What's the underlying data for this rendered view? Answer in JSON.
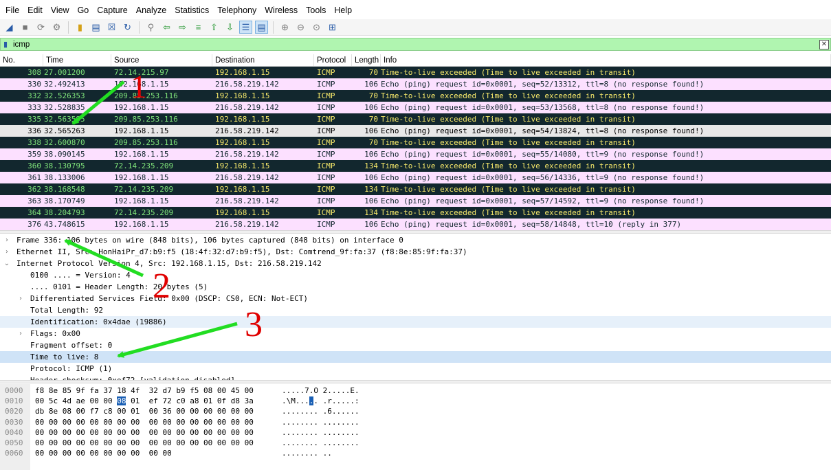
{
  "menu": [
    "File",
    "Edit",
    "View",
    "Go",
    "Capture",
    "Analyze",
    "Statistics",
    "Telephony",
    "Wireless",
    "Tools",
    "Help"
  ],
  "toolbar": {
    "icons": [
      "shark-fin-start-icon",
      "stop-square-icon",
      "restart-icon",
      "capture-options-gear-icon",
      "open-folder-icon",
      "save-file-icon",
      "close-file-icon",
      "reload-icon",
      "find-magnifier-icon",
      "go-back-arrow-icon",
      "go-forward-arrow-icon",
      "go-to-packet-icon",
      "go-first-icon",
      "go-last-icon",
      "autoscroll-icon",
      "colorize-icon",
      "zoom-in-icon",
      "zoom-out-icon",
      "zoom-normal-icon",
      "resize-columns-icon"
    ]
  },
  "filter": {
    "value": "icmp"
  },
  "columns": [
    "No.",
    "Time",
    "Source",
    "Destination",
    "Protocol",
    "Length",
    "Info"
  ],
  "packets": [
    {
      "no": "308",
      "time": "27.001200",
      "src": "72.14.215.97",
      "dst": "192.168.1.15",
      "proto": "ICMP",
      "len": "70",
      "info": "Time-to-live exceeded (Time to live exceeded in transit)",
      "style": "dark"
    },
    {
      "no": "330",
      "time": "32.492413",
      "src": "192.168.1.15",
      "dst": "216.58.219.142",
      "proto": "ICMP",
      "len": "106",
      "info": "Echo (ping) request  id=0x0001, seq=52/13312, ttl=8 (no response found!)",
      "style": "pink"
    },
    {
      "no": "332",
      "time": "32.526353",
      "src": "209.85.253.116",
      "dst": "192.168.1.15",
      "proto": "ICMP",
      "len": "70",
      "info": "Time-to-live exceeded (Time to live exceeded in transit)",
      "style": "dark"
    },
    {
      "no": "333",
      "time": "32.528835",
      "src": "192.168.1.15",
      "dst": "216.58.219.142",
      "proto": "ICMP",
      "len": "106",
      "info": "Echo (ping) request  id=0x0001, seq=53/13568, ttl=8 (no response found!)",
      "style": "pink"
    },
    {
      "no": "335",
      "time": "32.563595",
      "src": "209.85.253.116",
      "dst": "192.168.1.15",
      "proto": "ICMP",
      "len": "70",
      "info": "Time-to-live exceeded (Time to live exceeded in transit)",
      "style": "dark"
    },
    {
      "no": "336",
      "time": "32.565263",
      "src": "192.168.1.15",
      "dst": "216.58.219.142",
      "proto": "ICMP",
      "len": "106",
      "info": "Echo (ping) request  id=0x0001, seq=54/13824, ttl=8 (no response found!)",
      "style": "sel"
    },
    {
      "no": "338",
      "time": "32.600870",
      "src": "209.85.253.116",
      "dst": "192.168.1.15",
      "proto": "ICMP",
      "len": "70",
      "info": "Time-to-live exceeded (Time to live exceeded in transit)",
      "style": "dark"
    },
    {
      "no": "359",
      "time": "38.090145",
      "src": "192.168.1.15",
      "dst": "216.58.219.142",
      "proto": "ICMP",
      "len": "106",
      "info": "Echo (ping) request  id=0x0001, seq=55/14080, ttl=9 (no response found!)",
      "style": "pink"
    },
    {
      "no": "360",
      "time": "38.130795",
      "src": "72.14.235.209",
      "dst": "192.168.1.15",
      "proto": "ICMP",
      "len": "134",
      "info": "Time-to-live exceeded (Time to live exceeded in transit)",
      "style": "dark"
    },
    {
      "no": "361",
      "time": "38.133006",
      "src": "192.168.1.15",
      "dst": "216.58.219.142",
      "proto": "ICMP",
      "len": "106",
      "info": "Echo (ping) request  id=0x0001, seq=56/14336, ttl=9 (no response found!)",
      "style": "pink"
    },
    {
      "no": "362",
      "time": "38.168548",
      "src": "72.14.235.209",
      "dst": "192.168.1.15",
      "proto": "ICMP",
      "len": "134",
      "info": "Time-to-live exceeded (Time to live exceeded in transit)",
      "style": "dark"
    },
    {
      "no": "363",
      "time": "38.170749",
      "src": "192.168.1.15",
      "dst": "216.58.219.142",
      "proto": "ICMP",
      "len": "106",
      "info": "Echo (ping) request  id=0x0001, seq=57/14592, ttl=9 (no response found!)",
      "style": "pink"
    },
    {
      "no": "364",
      "time": "38.204793",
      "src": "72.14.235.209",
      "dst": "192.168.1.15",
      "proto": "ICMP",
      "len": "134",
      "info": "Time-to-live exceeded (Time to live exceeded in transit)",
      "style": "dark"
    },
    {
      "no": "376",
      "time": "43.748615",
      "src": "192.168.1.15",
      "dst": "216.58.219.142",
      "proto": "ICMP",
      "len": "106",
      "info": "Echo (ping) request  id=0x0001, seq=58/14848, ttl=10 (reply in 377)",
      "style": "pink"
    }
  ],
  "details": [
    {
      "text": "Frame 336: 106 bytes on wire (848 bits), 106 bytes captured (848 bits) on interface 0",
      "level": 0,
      "arrow": "collapsed"
    },
    {
      "text": "Ethernet II, Src: HonHaiPr_d7:b9:f5 (18:4f:32:d7:b9:f5), Dst: Comtrend_9f:fa:37 (f8:8e:85:9f:fa:37)",
      "level": 0,
      "arrow": "collapsed"
    },
    {
      "text": "Internet Protocol Version 4, Src: 192.168.1.15, Dst: 216.58.219.142",
      "level": 0,
      "arrow": "expanded"
    },
    {
      "text": "0100 .... = Version: 4",
      "level": 1,
      "arrow": ""
    },
    {
      "text": ".... 0101 = Header Length: 20 bytes (5)",
      "level": 1,
      "arrow": ""
    },
    {
      "text": "Differentiated Services Field: 0x00 (DSCP: CS0, ECN: Not-ECT)",
      "level": 1,
      "arrow": "collapsed"
    },
    {
      "text": "Total Length: 92",
      "level": 1,
      "arrow": ""
    },
    {
      "text": "Identification: 0x4dae (19886)",
      "level": 1,
      "arrow": "",
      "style": "hl"
    },
    {
      "text": "Flags: 0x00",
      "level": 1,
      "arrow": "collapsed"
    },
    {
      "text": "Fragment offset: 0",
      "level": 1,
      "arrow": ""
    },
    {
      "text": "Time to live: 8",
      "level": 1,
      "arrow": "",
      "style": "sel"
    },
    {
      "text": "Protocol: ICMP (1)",
      "level": 1,
      "arrow": ""
    },
    {
      "text": "Header checksum: 0xef72 [validation disabled]",
      "level": 1,
      "arrow": ""
    }
  ],
  "hex": [
    {
      "off": "0000",
      "b1": "f8 8e 85 9f fa 37 18 4f",
      "b2": "32 d7 b9 f5 08 00 45 00",
      "a1": ".....7.O",
      "a2": "2.....E."
    },
    {
      "off": "0010",
      "b1": "00 5c 4d ae 00 00 08 01",
      "b2": "ef 72 c0 a8 01 0f d8 3a",
      "a1": ".\\M.....",
      "a2": ".r.....:"
    },
    {
      "off": "0020",
      "b1": "db 8e 08 00 f7 c8 00 01",
      "b2": "00 36 00 00 00 00 00 00",
      "a1": "........",
      "a2": ".6......"
    },
    {
      "off": "0030",
      "b1": "00 00 00 00 00 00 00 00",
      "b2": "00 00 00 00 00 00 00 00",
      "a1": "........",
      "a2": "........"
    },
    {
      "off": "0040",
      "b1": "00 00 00 00 00 00 00 00",
      "b2": "00 00 00 00 00 00 00 00",
      "a1": "........",
      "a2": "........"
    },
    {
      "off": "0050",
      "b1": "00 00 00 00 00 00 00 00",
      "b2": "00 00 00 00 00 00 00 00",
      "a1": "........",
      "a2": "........"
    },
    {
      "off": "0060",
      "b1": "00 00 00 00 00 00 00 00",
      "b2": "00 00",
      "a1": "........",
      "a2": ".."
    }
  ],
  "annotations": [
    "1",
    "2",
    "3"
  ],
  "colors": {
    "row_dark_bg": "#12272e",
    "row_dark_fg": "#f7e96b",
    "row_pink_bg": "#fce0ff",
    "filter_bg": "#b0f5b0",
    "selection": "#cfe3f7",
    "arrow_green": "#22dd22",
    "annot_red": "#e00000"
  }
}
